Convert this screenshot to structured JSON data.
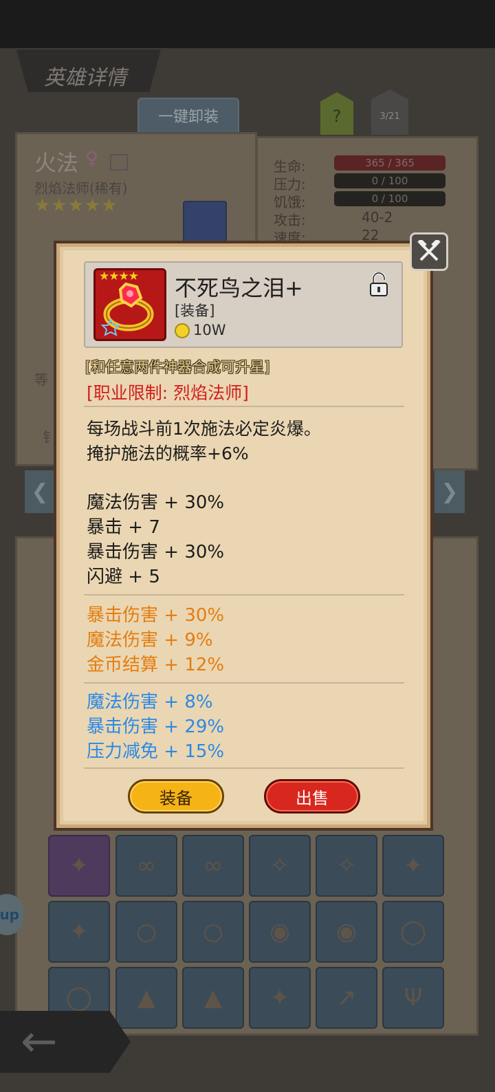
{
  "page": {
    "title": "英雄详情"
  },
  "toolbar": {
    "unequip_all_label": "一键卸装",
    "help_label": "?",
    "page_counter": "3/21"
  },
  "hero": {
    "name": "火法",
    "gender_symbol": "♀",
    "class_label": "烈焰法师(稀有)",
    "stars": "★★★★★"
  },
  "stats": {
    "hp_label": "生命:",
    "hp_value": "365 / 365",
    "pressure_label": "压力:",
    "pressure_value": "0 / 100",
    "hunger_label": "饥饿:",
    "hunger_value": "0 / 100",
    "attack_label": "攻击:",
    "attack_value": "40-2",
    "speed_label": "速度:",
    "speed_value": "22"
  },
  "background_fragments": {
    "left_text_a": "等",
    "left_text_b": "钅"
  },
  "item": {
    "name": "不死鸟之泪+",
    "type": "[装备]",
    "price": "10W",
    "stars": "★★★★",
    "hint": "[和任意两件神器合成可升星]",
    "restriction": "[职业限制: 烈焰法师]",
    "description": [
      "每场战斗前1次施法必定炎爆。",
      "掩护施法的概率+6%"
    ],
    "base_stats": [
      "魔法伤害 + 30%",
      "暴击 + 7",
      "暴击伤害 + 30%",
      "闪避 + 5"
    ],
    "orange_stats": [
      "暴击伤害 + 30%",
      "魔法伤害 + 9%",
      "金币结算 + 12%"
    ],
    "blue_stats": [
      "魔法伤害 + 8%",
      "暴击伤害 + 29%",
      "压力减免 + 15%"
    ]
  },
  "buttons": {
    "equip": "装备",
    "sell": "出售"
  },
  "side_pill": {
    "label": "up"
  },
  "colors": {
    "restriction": "#d21d1d",
    "orange_affix": "#e47d10",
    "blue_affix": "#2b89e6",
    "equip_button": "#f5b315",
    "sell_button": "#d8271e",
    "modal_bg": "#ead6b2"
  },
  "icons": {
    "close": "crossed-hammers-icon",
    "lock": "unlocked-padlock-icon",
    "coin": "gold-coin-icon",
    "item": "ruby-ring-icon"
  }
}
